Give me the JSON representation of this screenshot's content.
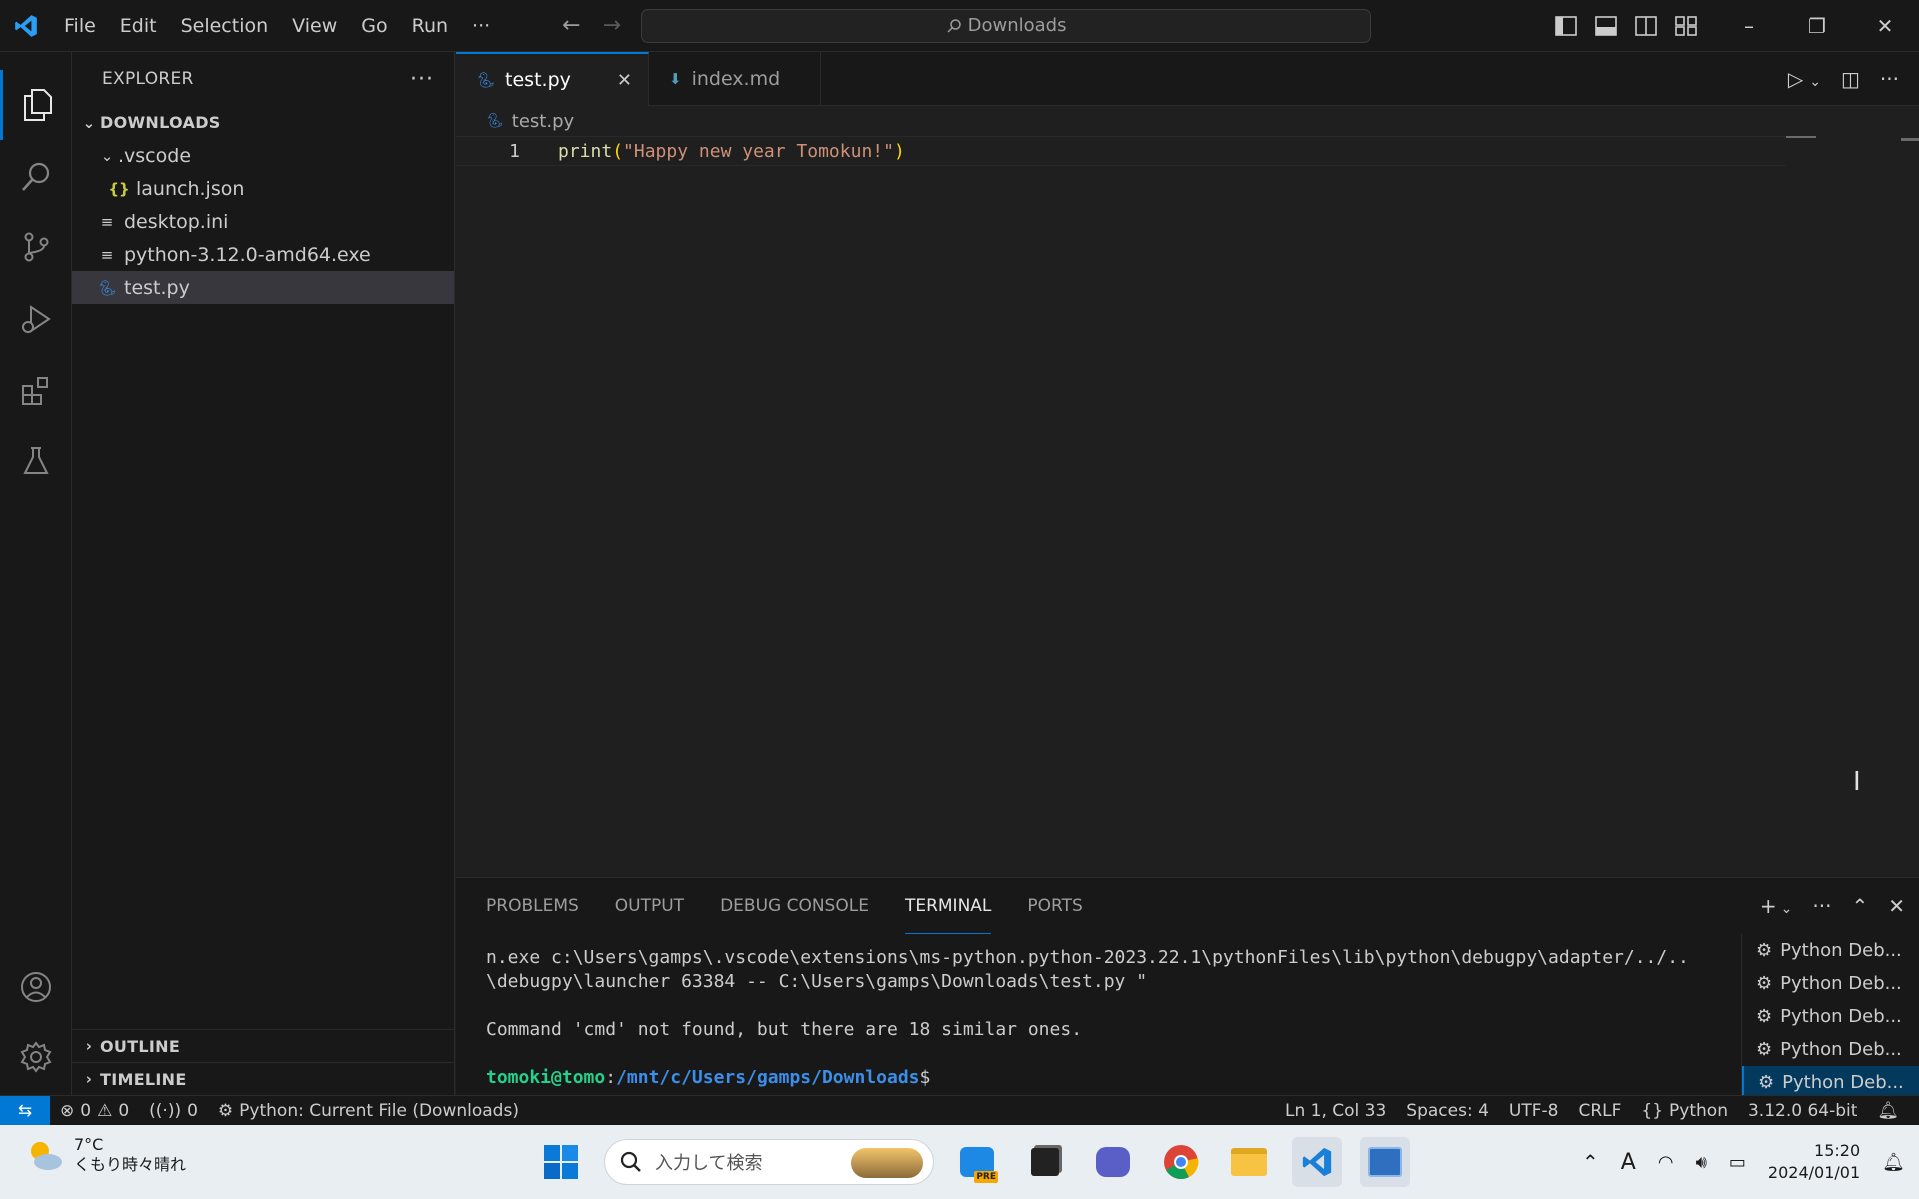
{
  "titlebar": {
    "menu": [
      "File",
      "Edit",
      "Selection",
      "View",
      "Go",
      "Run",
      "···"
    ],
    "search_text": "Downloads"
  },
  "sidebar": {
    "title": "EXPLORER",
    "root": "DOWNLOADS",
    "tree": [
      {
        "label": ".vscode",
        "type": "folder"
      },
      {
        "label": "launch.json",
        "type": "json"
      },
      {
        "label": "desktop.ini",
        "type": "file"
      },
      {
        "label": "python-3.12.0-amd64.exe",
        "type": "file"
      },
      {
        "label": "test.py",
        "type": "python"
      }
    ],
    "outline": "OUTLINE",
    "timeline": "TIMELINE"
  },
  "editor": {
    "tabs": [
      {
        "label": "test.py"
      },
      {
        "label": "index.md"
      }
    ],
    "breadcrumb": "test.py",
    "line_number": "1",
    "code": {
      "fn": "print",
      "open": "(",
      "str": "\"Happy new year Tomokun!\"",
      "close": ")"
    }
  },
  "panel": {
    "tabs": [
      "PROBLEMS",
      "OUTPUT",
      "DEBUG CONSOLE",
      "TERMINAL",
      "PORTS"
    ],
    "terminal": {
      "line1": "n.exe c:\\Users\\gamps\\.vscode\\extensions\\ms-python.python-2023.22.1\\pythonFiles\\lib\\python\\debugpy\\adapter/../..",
      "line2": "\\debugpy\\launcher 63384 -- C:\\Users\\gamps\\Downloads\\test.py \"",
      "line3": "",
      "line4": "Command 'cmd' not found, but there are 18 similar ones.",
      "line5": "",
      "prompt_user": "tomoki@tomo",
      "prompt_sep": ":",
      "prompt_path": "/mnt/c/Users/gamps/Downloads",
      "prompt_end": "$"
    },
    "terminal_list": [
      "Python Deb...",
      "Python Deb...",
      "Python Deb...",
      "Python Deb...",
      "Python Deb..."
    ]
  },
  "statusbar": {
    "errors": "0",
    "warnings": "0",
    "ports": "0",
    "debug_config": "Python: Current File (Downloads)",
    "position": "Ln 1, Col 33",
    "spaces": "Spaces: 4",
    "encoding": "UTF-8",
    "eol": "CRLF",
    "language": "Python",
    "interpreter": "3.12.0 64-bit"
  },
  "taskbar": {
    "temperature": "7°C",
    "weather": "くもり時々晴れ",
    "search_placeholder": "入力して検索",
    "time": "15:20",
    "date": "2024/01/01",
    "ime": "A"
  },
  "colors": {
    "accent": "#0078d4",
    "tab_close": "#cccccc",
    "python_icon": "#3b8eea",
    "json_icon": "#cbcb41"
  }
}
